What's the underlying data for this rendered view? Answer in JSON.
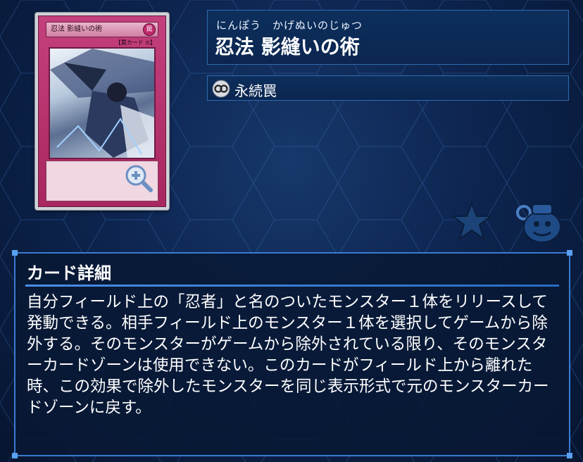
{
  "card": {
    "ruby": "にんぽう　かげぬいのじゅつ",
    "name": "忍法 影縫いの術",
    "card_name_small": "忍法 影縫いの術",
    "card_attr": "罠",
    "card_type_small": "【罠カード ⊙】",
    "type_label": "永続罠",
    "type_icon": "continuous-icon"
  },
  "detail": {
    "heading": "カード詳細",
    "text": "自分フィールド上の「忍者」と名のついたモンスター１体をリリースして発動できる。相手フィールド上のモンスター１体を選択してゲームから除外する。そのモンスターがゲームから除外されている限り、そのモンスターカードゾーンは使用できない。このカードがフィールド上から離れた時、この効果で除外したモンスターを同じ表示形式で元のモンスターカードゾーンに戻す。"
  },
  "icons": {
    "zoom": "zoom-in-icon",
    "favorite": "star-icon",
    "pot": "pot-of-greed-icon"
  },
  "colors": {
    "panel_border": "#2f6bb0",
    "trap_card": "#b8306f",
    "accent": "#5aa0f0"
  }
}
